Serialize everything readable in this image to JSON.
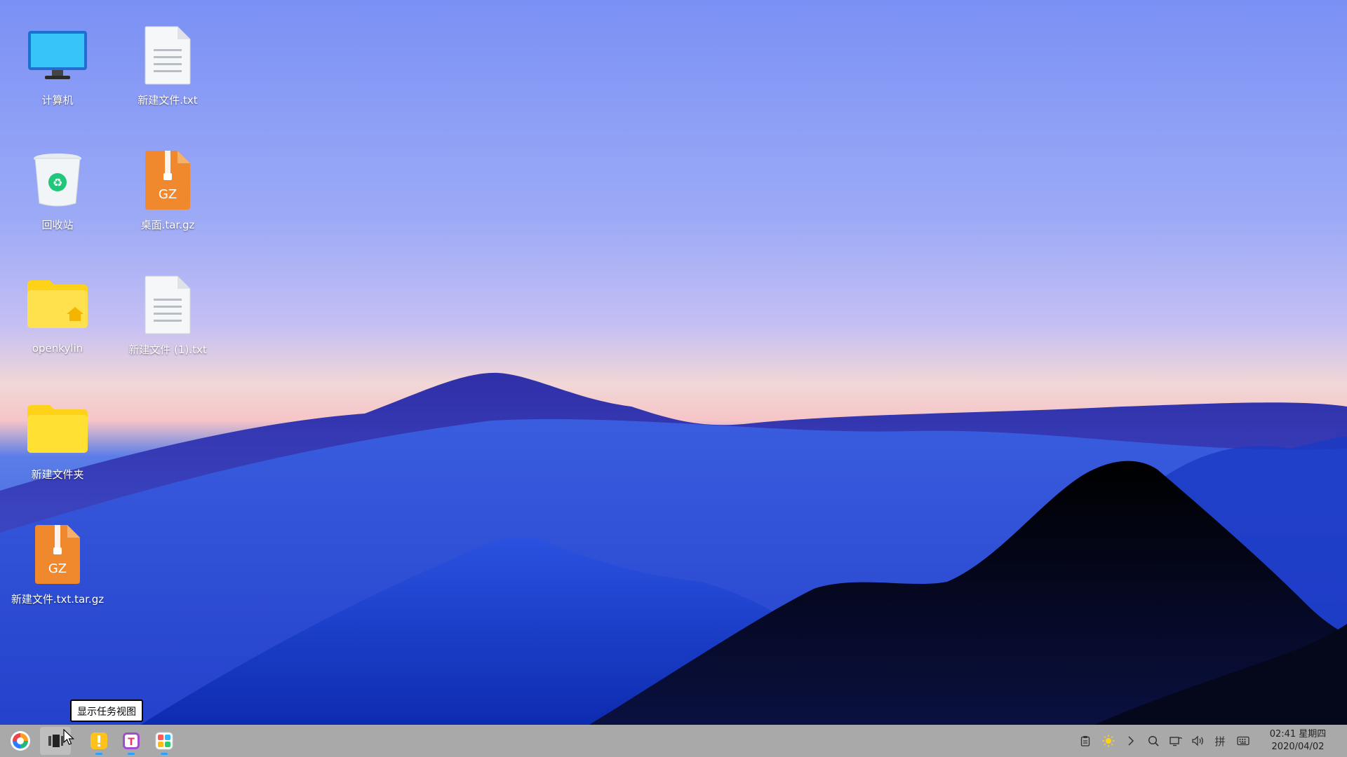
{
  "desktop": {
    "icons": [
      {
        "label": "计算机",
        "icon": "computer-icon"
      },
      {
        "label": "新建文件.txt",
        "icon": "text-file-icon"
      },
      {
        "label": "回收站",
        "icon": "trash-icon"
      },
      {
        "label": "桌面.tar.gz",
        "icon": "archive-gz-icon",
        "badge": "GZ"
      },
      {
        "label": "openkylin",
        "icon": "home-folder-icon"
      },
      {
        "label": "新建文件 (1).txt",
        "icon": "text-file-icon"
      },
      {
        "label": "新建文件夹",
        "icon": "folder-icon"
      },
      {
        "label": "新建文件.txt.tar.gz",
        "icon": "archive-gz-icon",
        "badge": "GZ"
      }
    ]
  },
  "tooltip": {
    "text": "显示任务视图"
  },
  "taskbar": {
    "apps": [
      {
        "name": "start-menu",
        "icon": "start-menu-icon"
      },
      {
        "name": "task-view",
        "icon": "task-view-icon"
      },
      {
        "name": "notes",
        "icon": "notes-app-icon",
        "running": true
      },
      {
        "name": "text-editor",
        "icon": "text-editor-icon",
        "glyph": "T",
        "running": true
      },
      {
        "name": "app-store",
        "icon": "app-store-icon",
        "running": true
      }
    ],
    "tray": [
      {
        "name": "clipboard",
        "icon": "clipboard-icon"
      },
      {
        "name": "brightness",
        "icon": "sun-icon"
      },
      {
        "name": "expand",
        "icon": "chevron-right-icon"
      },
      {
        "name": "search",
        "icon": "search-icon"
      },
      {
        "name": "network",
        "icon": "network-icon"
      },
      {
        "name": "volume",
        "icon": "volume-icon"
      },
      {
        "name": "input-method",
        "icon": "input-method-icon",
        "text": "拼"
      },
      {
        "name": "keyboard",
        "icon": "keyboard-icon"
      }
    ],
    "clock": {
      "time": "02:41 星期四",
      "date": "2020/04/02"
    }
  },
  "colors": {
    "taskbar_bg": "#a9a9a9",
    "archive_orange": "#f0882e",
    "folder_yellow": "#ffd21a",
    "running_indicator": "#2aa1ff"
  }
}
